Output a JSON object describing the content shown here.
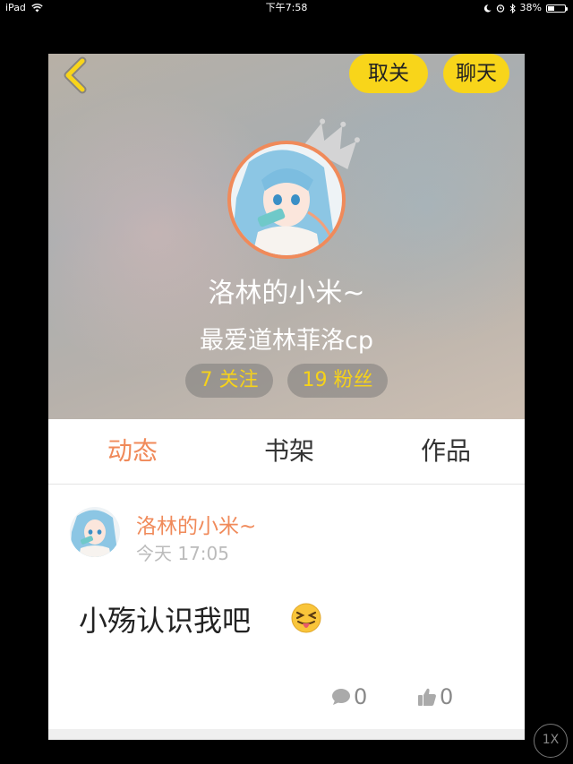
{
  "status_bar": {
    "device": "iPad",
    "time": "下午7:58",
    "battery": "38%",
    "battery_level": 0.38,
    "icons": [
      "wifi-icon",
      "moon-icon",
      "alarm-icon",
      "bluetooth-icon",
      "battery-icon"
    ]
  },
  "header": {
    "back_icon": "chevron-left-icon",
    "unfollow_label": "取关",
    "chat_label": "聊天",
    "nickname": "洛林的小米~",
    "bio": "最爱道林菲洛cp",
    "following_label": "7 关注",
    "fans_label": "19 粉丝"
  },
  "tabs": [
    {
      "label": "动态",
      "active": true
    },
    {
      "label": "书架",
      "active": false
    },
    {
      "label": "作品",
      "active": false
    }
  ],
  "post": {
    "author": "洛林的小米~",
    "time": "今天 17:05",
    "text": "小殇认识我吧",
    "emoji": "squinting-tongue-emoji",
    "comment_icon": "comment-bubble-icon",
    "comment_count": "0",
    "like_icon": "thumbs-up-icon",
    "like_count": "0"
  },
  "zoom_label": "1X",
  "colors": {
    "accent_orange": "#f08a5a",
    "button_yellow": "#f8d51a",
    "stat_text_yellow": "#f6d21a"
  }
}
